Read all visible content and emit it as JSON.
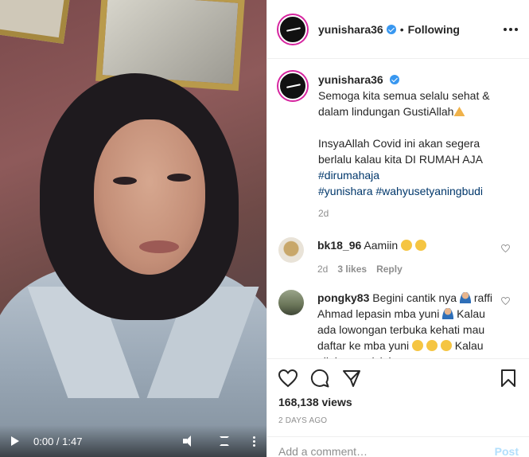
{
  "video": {
    "time": "0:00 / 1:47",
    "play_icon": "play-icon",
    "volume_icon": "volume-icon",
    "fullscreen_icon": "fullscreen-icon",
    "more_icon": "more-vertical-icon"
  },
  "header": {
    "username": "yunishara36",
    "separator": "•",
    "follow_status": "Following"
  },
  "caption": {
    "username": "yunishara36",
    "line1": "Semoga kita semua selalu sehat & dalam lindungan GustiAllah",
    "line2": "InsyaAllah Covid ini akan segera berlalu kalau kita DI RUMAH AJA",
    "hashtag1": "#dirumahaja",
    "hashtag2": "#yunishara #wahyusetyaningbudi",
    "age": "2d"
  },
  "comments": [
    {
      "username": "bk18_96",
      "text": "Aamiin",
      "age": "2d",
      "likes": "3 likes",
      "reply": "Reply"
    },
    {
      "username": "pongky83",
      "text1": "Begini cantik nya",
      "text2": "raffi Ahmad lepasin mba yuni",
      "text3": "Kalau ada lowongan terbuka kehati mau daftar ke mba yuni",
      "text4": "Kalau allah mengizinkan"
    }
  ],
  "actions": {
    "views": "168,138 views",
    "date": "2 DAYS AGO"
  },
  "add_comment": {
    "placeholder": "Add a comment…",
    "post_label": "Post"
  },
  "colors": {
    "link": "#00376b",
    "verified": "#3897f0",
    "post_disabled": "#b2dffc",
    "muted": "#8e8e8e"
  }
}
